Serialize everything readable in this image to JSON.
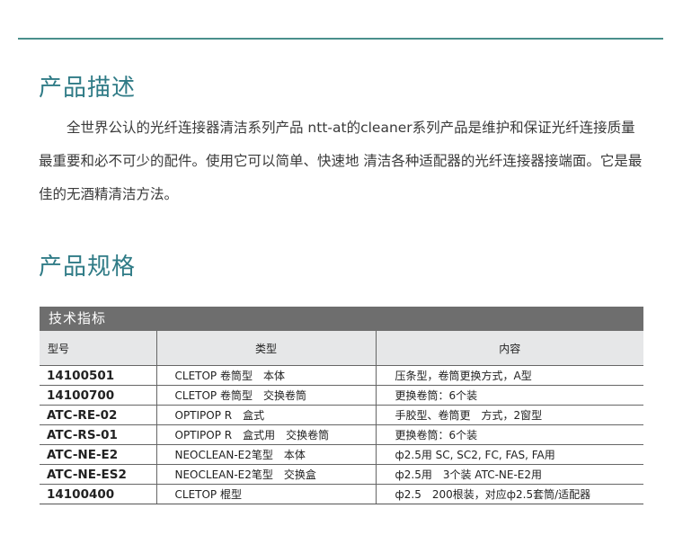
{
  "section_description": {
    "heading": "产品描述",
    "text": "全世界公认的光纤连接器清洁系列产品 ntt-at的cleaner系列产品是维护和保证光纤连接质量最重要和必不可少的配件。使用它可以简单、快速地 清洁各种适配器的光纤连接器接端面。它是最佳的无酒精清洁方法。"
  },
  "section_spec": {
    "heading": "产品规格",
    "table_title": "技术指标",
    "columns": [
      "型号",
      "类型",
      "内容"
    ],
    "rows": [
      {
        "model": "14100501",
        "type": "CLETOP 卷筒型　本体",
        "content": "压条型，卷筒更换方式，A型"
      },
      {
        "model": "14100700",
        "type": "CLETOP 卷筒型　交换卷筒",
        "content": "更换卷筒：6个装"
      },
      {
        "model": "ATC-RE-02",
        "type": "OPTIPOP R　盒式",
        "content": "手胶型、卷筒更　方式，2窗型"
      },
      {
        "model": "ATC-RS-01",
        "type": "OPTIPOP R　盒式用　交换卷筒",
        "content": "更换卷筒：6个装"
      },
      {
        "model": "ATC-NE-E2",
        "type": "NEOCLEAN-E2笔型　本体",
        "content": "ф2.5用 SC, SC2, FC, FAS, FA用"
      },
      {
        "model": "ATC-NE-ES2",
        "type": "NEOCLEAN-E2笔型　交换盒",
        "content": "ф2.5用　3个装 ATC-NE-E2用"
      },
      {
        "model": "14100400",
        "type": "CLETOP 棍型",
        "content": "ф2.5　200根装，对应ф2.5套筒/适配器"
      }
    ]
  }
}
